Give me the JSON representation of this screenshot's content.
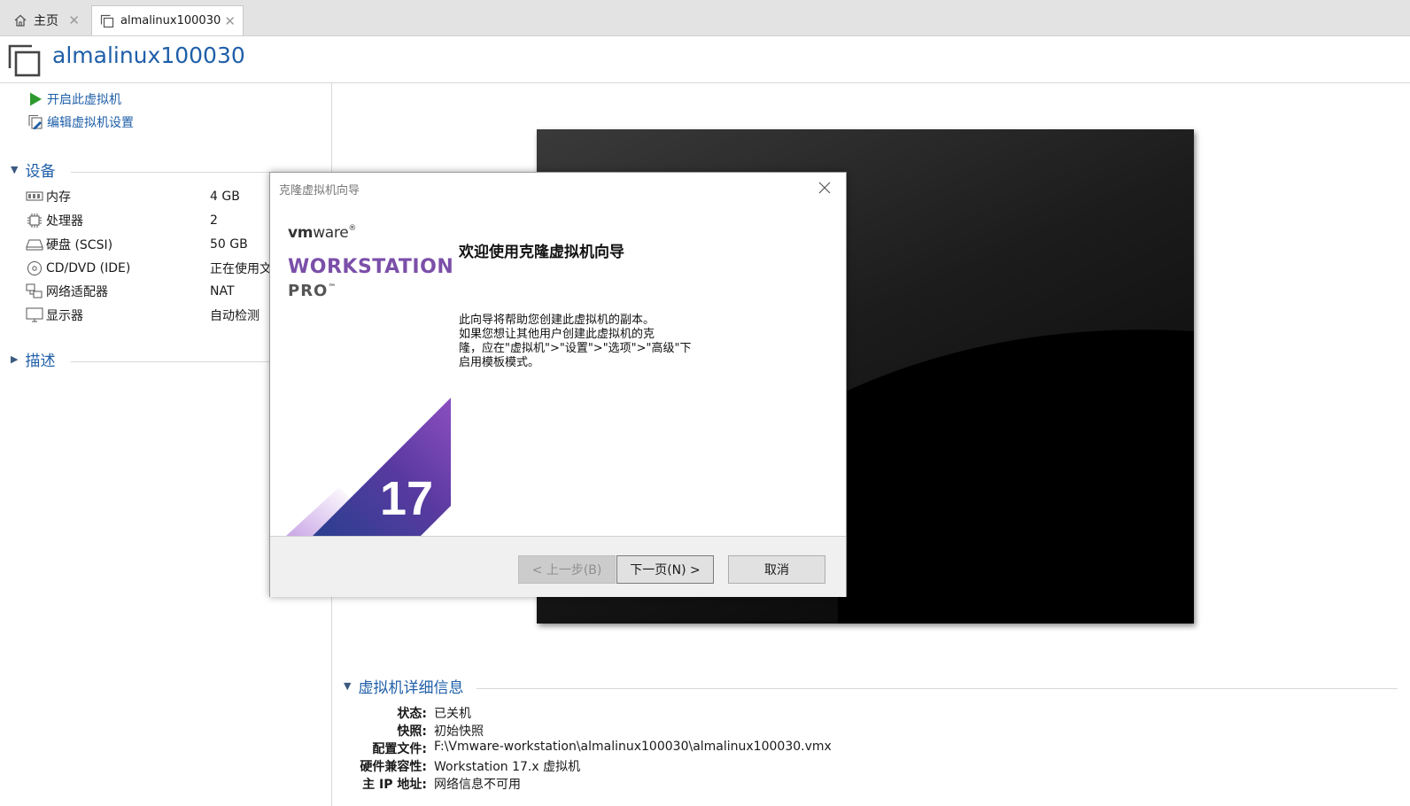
{
  "tabs": [
    {
      "label": "主页",
      "icon": "home-icon"
    },
    {
      "label": "almalinux100030",
      "icon": "vm-icon"
    }
  ],
  "header": {
    "title": "almalinux100030"
  },
  "actions": [
    {
      "label": "开启此虚拟机",
      "icon": "play-icon"
    },
    {
      "label": "编辑虚拟机设置",
      "icon": "edit-settings-icon"
    }
  ],
  "devices_section": {
    "title": "设备"
  },
  "devices": [
    {
      "name": "内存",
      "value": "4 GB",
      "icon": "memory-icon"
    },
    {
      "name": "处理器",
      "value": "2",
      "icon": "processor-icon"
    },
    {
      "name": "硬盘 (SCSI)",
      "value": "50 GB",
      "icon": "hard-disk-icon"
    },
    {
      "name": "CD/DVD (IDE)",
      "value": "正在使用文",
      "icon": "cd-dvd-icon"
    },
    {
      "name": "网络适配器",
      "value": "NAT",
      "icon": "network-adapter-icon"
    },
    {
      "name": "显示器",
      "value": "自动检测",
      "icon": "display-icon"
    }
  ],
  "description_section": {
    "title": "描述"
  },
  "details": {
    "title": "虚拟机详细信息",
    "rows": [
      {
        "key": "状态:",
        "value": "已关机"
      },
      {
        "key": "快照:",
        "value": "初始快照"
      },
      {
        "key": "配置文件:",
        "value": "F:\\Vmware-workstation\\almalinux100030\\almalinux100030.vmx"
      },
      {
        "key": "硬件兼容性:",
        "value": "Workstation 17.x 虚拟机"
      },
      {
        "key": "主 IP 地址:",
        "value": "网络信息不可用"
      }
    ]
  },
  "dialog": {
    "title": "克隆虚拟机向导",
    "brand": {
      "vm": "vm",
      "ware": "ware",
      "product": "WORKSTATION",
      "edition": "PRO",
      "tm": "™",
      "version": "17"
    },
    "heading": "欢迎使用克隆虚拟机向导",
    "body": "此向导将帮助您创建此虚拟机的副本。\n如果您想让其他用户创建此虚拟机的克\n隆，应在\"虚拟机\">\"设置\">\"选项\">\"高级\"下\n启用模板模式。",
    "buttons": {
      "back": "< 上一步(B)",
      "next": "下一页(N) >",
      "cancel": "取消"
    }
  },
  "colors": {
    "link": "#1f5fa8",
    "brand_purple": "#7b4fa9",
    "play_green": "#2e9a2e"
  }
}
